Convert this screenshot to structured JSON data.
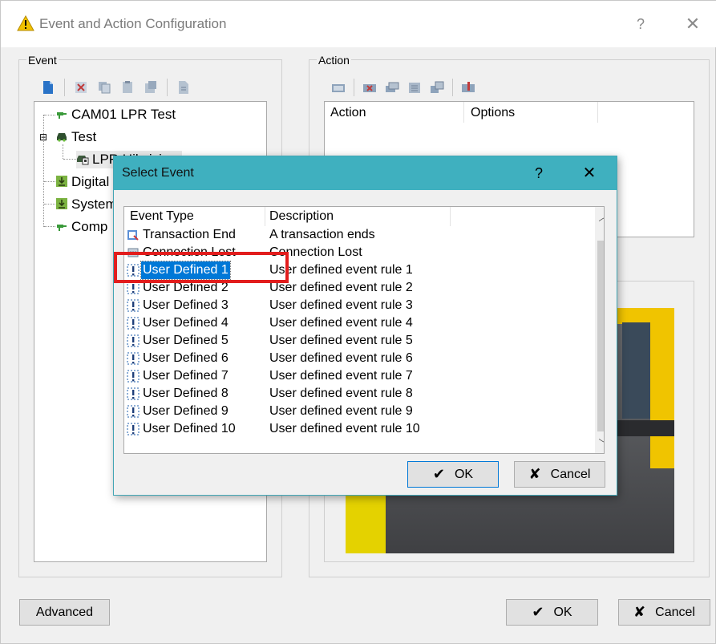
{
  "window": {
    "title": "Event and Action Configuration",
    "help_glyph": "?",
    "close_glyph": "✕"
  },
  "event_group": {
    "label": "Event",
    "tree": [
      {
        "label": "CAM01 LPR Test",
        "icon": "plug-icon"
      },
      {
        "label": "Test",
        "icon": "car-icon",
        "expander": "⊟"
      },
      {
        "label": "LPR Hikvision",
        "icon": "lpr-camera-icon"
      },
      {
        "label": "Digital Input",
        "icon": "digital-input-icon"
      },
      {
        "label": "System",
        "icon": "system-icon"
      },
      {
        "label": "Comp",
        "icon": "plug-icon"
      }
    ]
  },
  "action_group": {
    "label": "Action",
    "columns": [
      "Action",
      "Options"
    ]
  },
  "select_event": {
    "title": "Select Event",
    "help_glyph": "?",
    "close_glyph": "✕",
    "columns": [
      "Event Type",
      "Description"
    ],
    "rows": [
      {
        "type": "Transaction End",
        "desc": "A transaction ends",
        "icon": "transaction-icon"
      },
      {
        "type": "Connection Lost",
        "desc": "Connection Lost",
        "icon": "connection-lost-icon"
      },
      {
        "type": "User Defined 1",
        "desc": "User defined event rule 1",
        "icon": "exclamation-icon"
      },
      {
        "type": "User Defined 2",
        "desc": "User defined event rule 2",
        "icon": "exclamation-icon"
      },
      {
        "type": "User Defined 3",
        "desc": "User defined event rule 3",
        "icon": "exclamation-icon"
      },
      {
        "type": "User Defined 4",
        "desc": "User defined event rule 4",
        "icon": "exclamation-icon"
      },
      {
        "type": "User Defined 5",
        "desc": "User defined event rule 5",
        "icon": "exclamation-icon"
      },
      {
        "type": "User Defined 6",
        "desc": "User defined event rule 6",
        "icon": "exclamation-icon"
      },
      {
        "type": "User Defined 7",
        "desc": "User defined event rule 7",
        "icon": "exclamation-icon"
      },
      {
        "type": "User Defined 8",
        "desc": "User defined event rule 8",
        "icon": "exclamation-icon"
      },
      {
        "type": "User Defined 9",
        "desc": "User defined event rule 9",
        "icon": "exclamation-icon"
      },
      {
        "type": "User Defined 10",
        "desc": "User defined event rule 10",
        "icon": "exclamation-icon"
      }
    ],
    "selected_row": "User Defined 1",
    "ok_label": "OK",
    "cancel_label": "Cancel",
    "scroll_up_glyph": "︿",
    "scroll_down_glyph": "﹀"
  },
  "footer": {
    "advanced_label": "Advanced",
    "ok_label": "OK",
    "cancel_label": "Cancel"
  },
  "glyphs": {
    "check": "✔",
    "cross": "✘"
  },
  "colors": {
    "dialog_title_bg": "#3fb0bf",
    "selection_bg": "#0078d7",
    "highlight_border": "#e21d1d",
    "default_button_border": "#0078d7"
  }
}
